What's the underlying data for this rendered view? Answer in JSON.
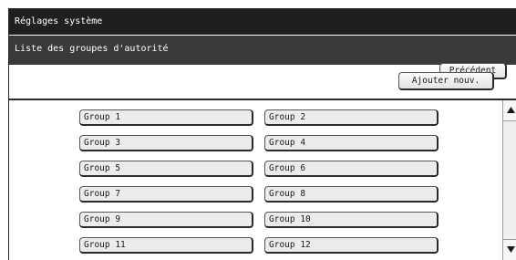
{
  "window": {
    "title": "Réglages système"
  },
  "header": {
    "subtitle": "Liste des groupes d'autorité",
    "back_label": "Précédent"
  },
  "toolbar": {
    "add_label": "Ajouter nouv."
  },
  "groups": [
    {
      "label": "Group 1"
    },
    {
      "label": "Group 2"
    },
    {
      "label": "Group 3"
    },
    {
      "label": "Group 4"
    },
    {
      "label": "Group 5"
    },
    {
      "label": "Group 6"
    },
    {
      "label": "Group 7"
    },
    {
      "label": "Group 8"
    },
    {
      "label": "Group 9"
    },
    {
      "label": "Group 10"
    },
    {
      "label": "Group 11"
    },
    {
      "label": "Group 12"
    }
  ],
  "scrollbar": {
    "up_icon": "triangle-up-icon",
    "down_icon": "triangle-down-icon"
  },
  "colors": {
    "title_bar": "#1f1f1f",
    "sub_bar": "#3a3a3a",
    "button_face": "#ececec"
  }
}
